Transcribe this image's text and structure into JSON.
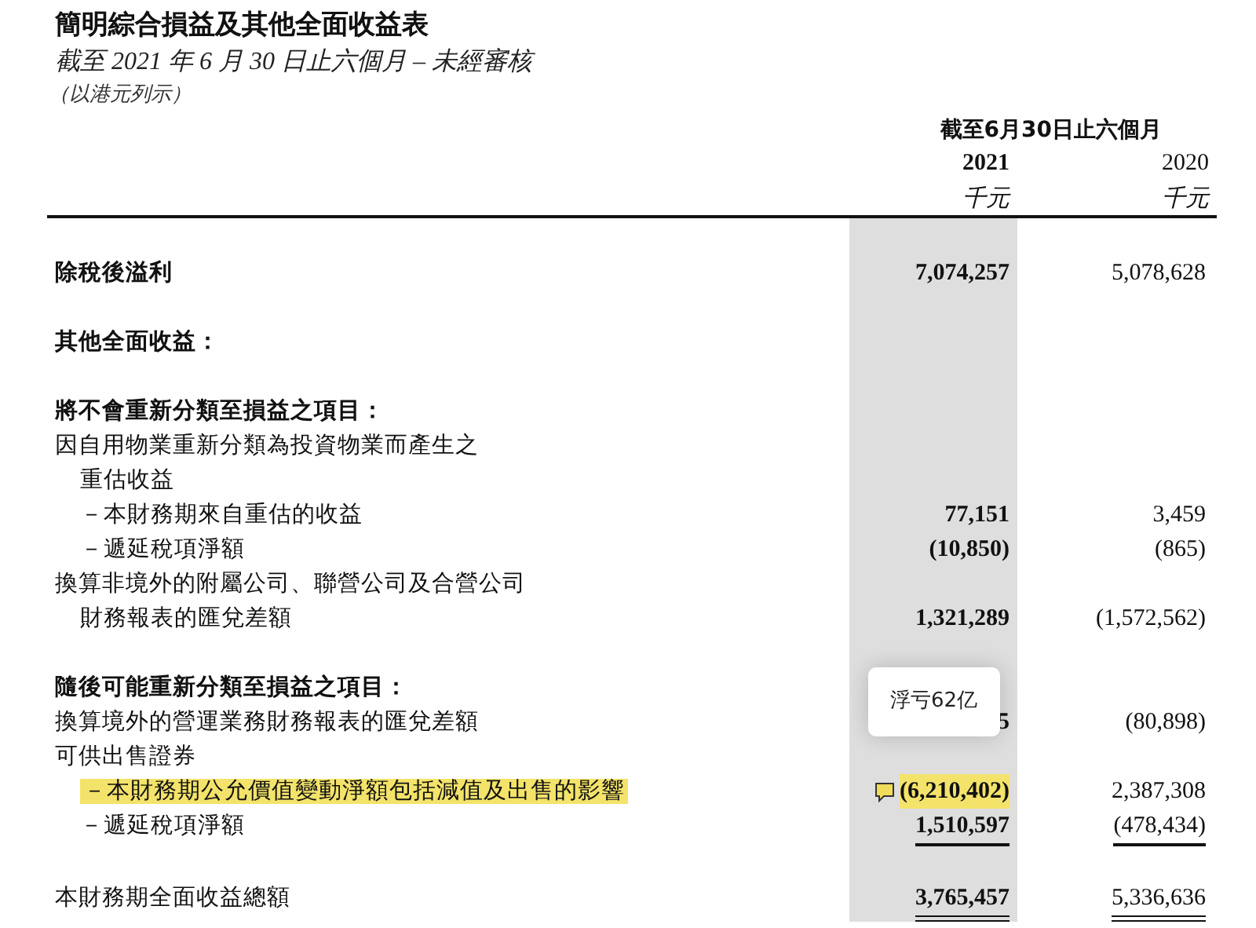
{
  "title": "簡明綜合損益及其他全面收益表",
  "subtitle": "截至 2021 年 6 月 30 日止六個月 – 未經審核",
  "currency_note": "（以港元列示）",
  "columns": {
    "period": "截至6月30日止六個月",
    "years": [
      {
        "year": "2021",
        "unit": "千元"
      },
      {
        "year": "2020",
        "unit": "千元"
      }
    ]
  },
  "rows": [
    {
      "kind": "subtotal",
      "label": "除稅後溢利",
      "v2021": "7,074,257",
      "v2020": "5,078,628"
    },
    {
      "kind": "heading",
      "label": "其他全面收益："
    },
    {
      "kind": "heading",
      "label": "將不會重新分類至損益之項目："
    },
    {
      "kind": "item",
      "label": "因自用物業重新分類為投資物業而產生之",
      "children": [
        {
          "kind": "item",
          "label": "重估收益"
        },
        {
          "kind": "item",
          "label": "－本財務期來自重估的收益",
          "v2021": "77,151",
          "v2020": "3,459"
        },
        {
          "kind": "item",
          "label": "－遞延稅項淨額",
          "v2021": "(10,850)",
          "v2020": "(865)"
        }
      ]
    },
    {
      "kind": "item",
      "label": "換算非境外的附屬公司、聯營公司及合營公司",
      "children": [
        {
          "kind": "item",
          "label": "財務報表的匯兌差額",
          "v2021": "1,321,289",
          "v2020": "(1,572,562)"
        }
      ]
    },
    {
      "kind": "heading",
      "label": "隨後可能重新分類至損益之項目："
    },
    {
      "kind": "item",
      "label": "換算境外的營運業務財務報表的匯兌差額",
      "v2021": "5",
      "v2020": "(80,898)"
    },
    {
      "kind": "item",
      "label": "可供出售證券",
      "children": [
        {
          "kind": "item",
          "label": "－本財務期公允價值變動淨額包括減值及出售的影響",
          "v2021": "(6,210,402)",
          "v2020": "2,387,308",
          "highlighted": true,
          "note": "浮亏62亿"
        },
        {
          "kind": "item",
          "label": "－遞延稅項淨額",
          "v2021": "1,510,597",
          "v2020": "(478,434)",
          "rule_below": true
        }
      ]
    },
    {
      "kind": "total",
      "label": "本財務期全面收益總額",
      "v2021": "3,765,457",
      "v2020": "5,336,636",
      "double_rule_below": true
    }
  ]
}
